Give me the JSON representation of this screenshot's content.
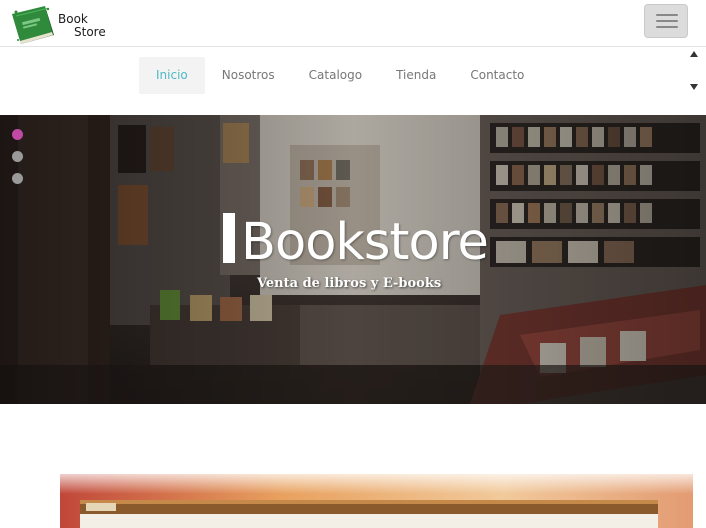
{
  "brand": {
    "line1": "Book",
    "line2": "Store",
    "logo_icon": "book-icon",
    "colors": {
      "book_green": "#2f8a3b",
      "book_dark": "#1f5e28"
    }
  },
  "menu_toggle": {
    "icon": "hamburger-icon"
  },
  "nav": {
    "items": [
      {
        "label": "Inicio",
        "active": true
      },
      {
        "label": "Nosotros",
        "active": false
      },
      {
        "label": "Catalogo",
        "active": false
      },
      {
        "label": "Tienda",
        "active": false
      },
      {
        "label": "Contacto",
        "active": false
      }
    ],
    "active_color": "#4fb9c5",
    "scroll_icons": [
      "arrow-up-icon",
      "arrow-down-icon"
    ]
  },
  "hero": {
    "title": "Bookstore",
    "subtitle": "Venta de libros y E-books",
    "slides": [
      {
        "active": true,
        "color": "#c24aa6"
      },
      {
        "active": false,
        "color": "#9a9a9a"
      },
      {
        "active": false,
        "color": "#9a9a9a"
      }
    ]
  }
}
